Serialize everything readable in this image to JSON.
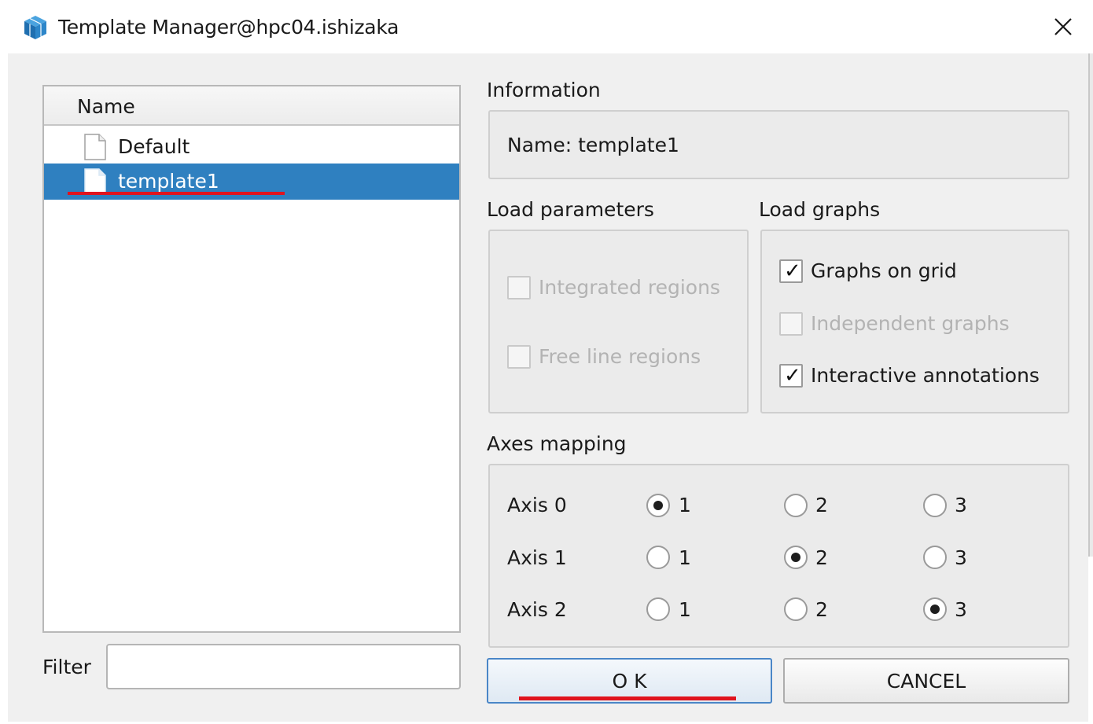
{
  "window": {
    "title": "Template Manager@hpc04.ishizaka",
    "accent_color": "#2f80c0"
  },
  "templates": {
    "column_header": "Name",
    "items": [
      {
        "label": "Default",
        "selected": false
      },
      {
        "label": "template1",
        "selected": true
      }
    ]
  },
  "filter": {
    "label": "Filter",
    "value": ""
  },
  "information": {
    "section_label": "Information",
    "name_text": "Name: template1"
  },
  "load_parameters": {
    "section_label": "Load parameters",
    "options": [
      {
        "label": "Integrated regions",
        "checked": false,
        "enabled": false
      },
      {
        "label": "Free line regions",
        "checked": false,
        "enabled": false
      }
    ]
  },
  "load_graphs": {
    "section_label": "Load graphs",
    "options": [
      {
        "label": "Graphs on grid",
        "checked": true,
        "enabled": true
      },
      {
        "label": "Independent graphs",
        "checked": false,
        "enabled": false
      },
      {
        "label": "Interactive annotations",
        "checked": true,
        "enabled": true
      }
    ]
  },
  "axes_mapping": {
    "section_label": "Axes mapping",
    "choices": [
      "1",
      "2",
      "3"
    ],
    "rows": [
      {
        "label": "Axis 0",
        "selected": "1"
      },
      {
        "label": "Axis 1",
        "selected": "2"
      },
      {
        "label": "Axis 2",
        "selected": "3"
      }
    ]
  },
  "buttons": {
    "ok_label": "O K",
    "cancel_label": "CANCEL"
  },
  "icons": {
    "app": "cube-icon",
    "close": "close-icon",
    "file": "file-icon"
  }
}
